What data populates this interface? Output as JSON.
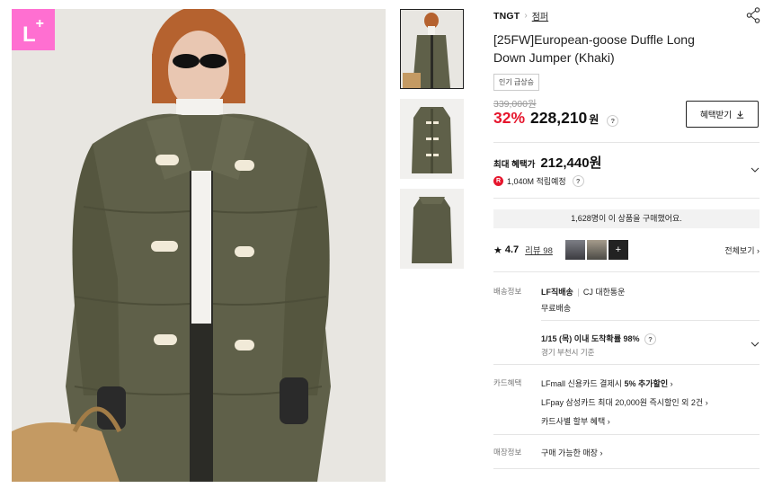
{
  "badge_logo": "L",
  "breadcrumb": {
    "brand": "TNGT",
    "separator": "›",
    "category": "점퍼"
  },
  "product": {
    "title": "[25FW]European-goose Duffle Long Down Jumper (Khaki)",
    "badge": "인기 급상승",
    "original_price": "339,000원",
    "discount": "32%",
    "price": "228,210",
    "price_unit": "원",
    "help_mark": "?"
  },
  "benefit_button": {
    "label": "혜택받기"
  },
  "max_benefit": {
    "label": "최대 혜택가",
    "price": "212,440원"
  },
  "points": {
    "icon": "R",
    "text": "1,040M 적립예정"
  },
  "buyers_banner": "1,628명이 이 상품을 구매했어요.",
  "review": {
    "star": "★",
    "rating": "4.7",
    "link": "리뷰 98",
    "more": "+",
    "view_all": "전체보기 ›"
  },
  "shipping": {
    "label": "배송정보",
    "method": "LF직배송",
    "carrier": "CJ 대한통운",
    "fee": "무료배송",
    "arrival": "1/15 (목) 이내 도착확률 98%",
    "origin": "경기 부천시 기준"
  },
  "card": {
    "label": "카드혜택",
    "line1_prefix": "LFmall 신용카드 결제시 ",
    "line1_bold": "5% 추가할인",
    "line2": "LFpay 삼성카드 최대 20,000원 즉시할인 외 2건",
    "line3": "카드사별 할부 혜택",
    "arrow": "›"
  },
  "store": {
    "label": "매장정보",
    "text": "구매 가능한 매장",
    "arrow": "›"
  },
  "colors": {
    "accent_red": "#e6162d",
    "lplus_pink": "#ff6fd1",
    "khaki": "#5f6049"
  }
}
